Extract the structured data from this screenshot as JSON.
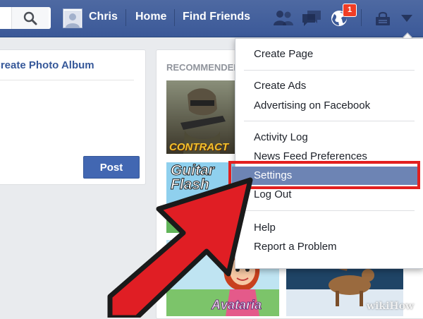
{
  "header": {
    "user_name": "Chris",
    "home_label": "Home",
    "find_friends_label": "Find Friends",
    "notification_count": "1",
    "icons": [
      "search-icon",
      "friend-requests-icon",
      "messages-icon",
      "notifications-globe-icon",
      "privacy-shortcuts-icon",
      "account-menu-arrow-icon"
    ],
    "bar_color": "#3b5998"
  },
  "composer": {
    "album_title": "Create Photo Album",
    "post_label": "Post"
  },
  "recommended": {
    "heading": "RECOMMENDED GAMES",
    "games": [
      {
        "label": "CONTRACT"
      },
      {
        "label": "Guitar Flash"
      },
      {
        "label": "Avataria"
      }
    ]
  },
  "account_menu": {
    "groups": [
      [
        "Create Page"
      ],
      [
        "Create Ads",
        "Advertising on Facebook"
      ],
      [
        "Activity Log",
        "News Feed Preferences",
        "Settings",
        "Log Out"
      ],
      [
        "Help",
        "Report a Problem"
      ]
    ],
    "selected": "Settings",
    "highlight_color": "#6d84b4"
  },
  "annotation": {
    "frame_color": "#e2201f",
    "arrow_color": "#e01e24",
    "watermark": "wikiHow"
  }
}
